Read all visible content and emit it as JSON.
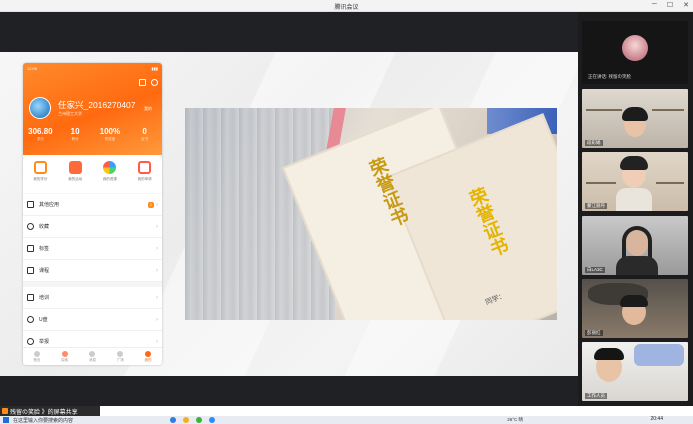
{
  "window": {
    "title": "腾讯会议"
  },
  "share": {
    "banner": "残留の笑脸 》的屏幕共享"
  },
  "phone": {
    "status_time": "12:09",
    "user_name": "任家兴_2016270407",
    "user_sub": "兰州理工大学",
    "tag": "我的",
    "stats": [
      {
        "value": "306.80",
        "label": "学分"
      },
      {
        "value": "10",
        "label": "积分"
      },
      {
        "value": "100%",
        "label": "完成度"
      },
      {
        "value": "0",
        "label": "证书"
      }
    ],
    "quick": [
      {
        "label": "我的学分",
        "color": "#ff8c1a"
      },
      {
        "label": "我的活动",
        "color": "#ff6a3d"
      },
      {
        "label": "我的资源",
        "color": "#3aa0ff"
      },
      {
        "label": "我的申请",
        "color": "#ff5a4a"
      }
    ],
    "menu": [
      {
        "label": "其他应用",
        "badge": "1"
      },
      {
        "label": "收藏"
      },
      {
        "label": "标签"
      },
      {
        "label": "课程"
      },
      {
        "label": "培训"
      },
      {
        "label": "U盘"
      },
      {
        "label": "举报"
      }
    ],
    "tabs": [
      {
        "label": "首页"
      },
      {
        "label": "探索"
      },
      {
        "label": "消息"
      },
      {
        "label": "广场"
      },
      {
        "label": "我的"
      }
    ]
  },
  "certificate": {
    "title_a": "荣誉证书",
    "title_b": "荣誉证书",
    "snippet": "同学："
  },
  "participants": {
    "speaker_label": "正在讲话: 残留の笑脸",
    "tiles": [
      {
        "name": "段彩娟"
      },
      {
        "name": "蒙江丽丹"
      },
      {
        "name": "白LA3C"
      },
      {
        "name": "彭丽红"
      },
      {
        "name": "工作人员"
      }
    ]
  },
  "taskbar": {
    "search_text": "在这里输入你要搜索的内容",
    "weather": "26°C 晴",
    "time": "20:44",
    "date": "2021/4/26"
  }
}
